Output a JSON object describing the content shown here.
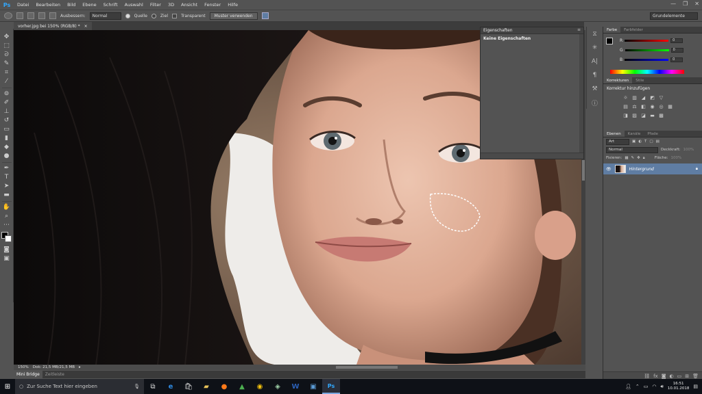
{
  "app": {
    "logo": "Ps"
  },
  "menubar": {
    "items": [
      "Datei",
      "Bearbeiten",
      "Bild",
      "Ebene",
      "Schrift",
      "Auswahl",
      "Filter",
      "3D",
      "Ansicht",
      "Fenster",
      "Hilfe"
    ],
    "window_controls": {
      "minimize": "—",
      "restore": "❐",
      "close": "✕"
    }
  },
  "options": {
    "ausbessern_label": "Ausbessern:",
    "ausbessern_value": "Normal",
    "quelle_label": "Quelle",
    "ziel_label": "Ziel",
    "transparent_label": "Transparent",
    "muster_button": "Muster verwenden",
    "workspace": "Grundelemente"
  },
  "document": {
    "tab_title": "vorher.jpg bei 150% (RGB/8) *",
    "close": "×"
  },
  "status": {
    "zoom": "150%",
    "doc_info": "Dok: 21,5 MB/21,5 MB",
    "arrow": "▸"
  },
  "minibridge": {
    "tab1": "Mini Bridge",
    "tab2": "Zeitleiste"
  },
  "properties": {
    "tab": "Eigenschaften",
    "title": "Keine Eigenschaften",
    "menu": "≡"
  },
  "color_panel": {
    "tab1": "Farbe",
    "tab2": "Farbfelder",
    "r_label": "R",
    "g_label": "G",
    "b_label": "B",
    "r_value": "0",
    "g_value": "0",
    "b_value": "0"
  },
  "korrekturen": {
    "tab1": "Korrekturen",
    "tab2": "Stile",
    "title": "Korrektur hinzufügen"
  },
  "layers": {
    "tab1": "Ebenen",
    "tab2": "Kanäle",
    "tab3": "Pfade",
    "filter": "Art",
    "blend": "Normal",
    "opacity_label": "Deckkraft:",
    "opacity_value": "100%",
    "lock_label": "Fixieren:",
    "fill_label": "Fläche:",
    "fill_value": "100%",
    "layer_name": "Hintergrund"
  },
  "taskbar": {
    "search_placeholder": "Zur Suche Text hier eingeben",
    "time": "16:51",
    "date": "10.01.2018"
  },
  "colors": {
    "accent": "#31a8ff",
    "layer_selected": "#5f7da3",
    "taskbar": "#0e1117"
  }
}
